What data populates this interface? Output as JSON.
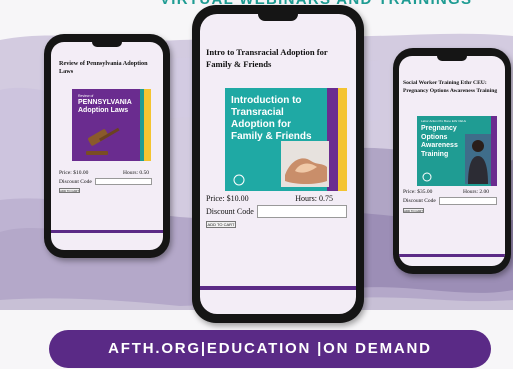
{
  "header": {
    "title": "VIRTUAL WEBINARS AND TRAININGS"
  },
  "banner": {
    "text": "AFTH.ORG|EDUCATION |ON DEMAND"
  },
  "colors": {
    "brand_purple": "#5a2a86",
    "teal": "#1f9c93",
    "yellow": "#f4c430"
  },
  "cards": {
    "left": {
      "title": "Review of Pennsylvania Adoption Laws",
      "thumb_small": "Review of",
      "thumb_main": "PENNSYLVANIA Adoption Laws",
      "price": "Price: $10.00",
      "hours": "Hours: 0.50",
      "discount_label": "Discount Code",
      "add_button": "ADD TO CART"
    },
    "center": {
      "title": "Intro to Transracial Adoption for Family & Friends",
      "thumb_main": "Introduction to Transracial Adoption for Family & Friends",
      "price": "Price: $10.00",
      "hours": "Hours: 0.75",
      "discount_label": "Discount Code",
      "add_button": "ADD TO CART"
    },
    "right": {
      "title": "Social Worker Training Ethr CEU: Pregnancy Options Awareness Training",
      "thumb_small": "Labor Action Pro Bono Ethr CEUs",
      "thumb_main": "Pregnancy Options Awareness Training",
      "price": "Price: $35.00",
      "hours": "Hours: 2.00",
      "discount_label": "Discount Code",
      "add_button": "ADD TO CART"
    }
  }
}
